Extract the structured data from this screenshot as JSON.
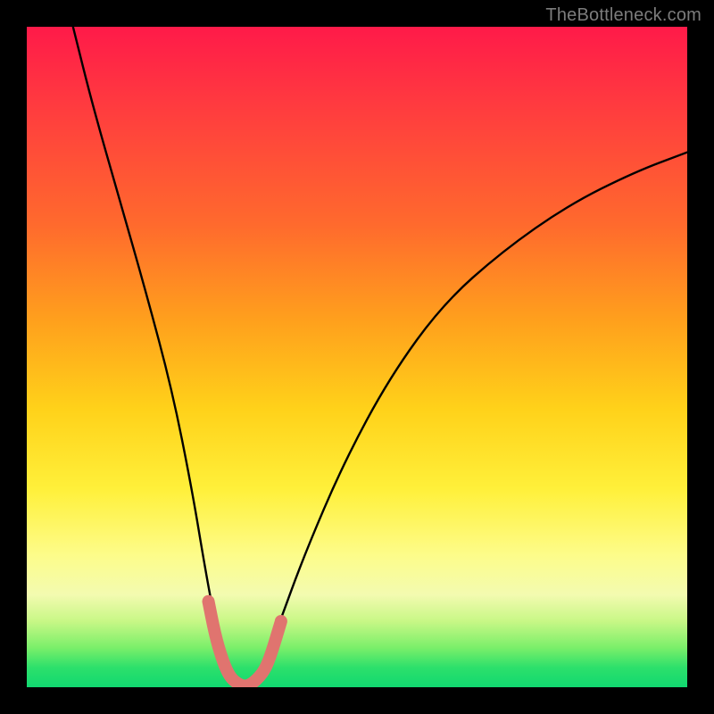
{
  "watermark": "TheBottleneck.com",
  "chart_data": {
    "type": "line",
    "title": "",
    "xlabel": "",
    "ylabel": "",
    "xlim": [
      0,
      100
    ],
    "ylim": [
      0,
      100
    ],
    "series": [
      {
        "name": "bottleneck-curve",
        "x": [
          7,
          10,
          14,
          18,
          22,
          25,
          27,
          28.5,
          30,
          31.5,
          33,
          34.5,
          36,
          38,
          42,
          48,
          55,
          63,
          72,
          82,
          92,
          100
        ],
        "values": [
          100,
          88,
          74,
          60,
          45,
          30,
          18,
          10,
          4,
          1.5,
          0,
          1.5,
          4,
          9,
          20,
          34,
          47,
          58,
          66,
          73,
          78,
          81
        ]
      }
    ],
    "highlight": {
      "name": "optimal-range",
      "color": "#e0746f",
      "x": [
        27.5,
        28.5,
        29.5,
        30.5,
        31.5,
        33,
        34.5,
        36,
        37,
        38.5
      ],
      "values": [
        13,
        8,
        4.5,
        2,
        0.8,
        0,
        0.8,
        2.5,
        5,
        10
      ]
    }
  }
}
